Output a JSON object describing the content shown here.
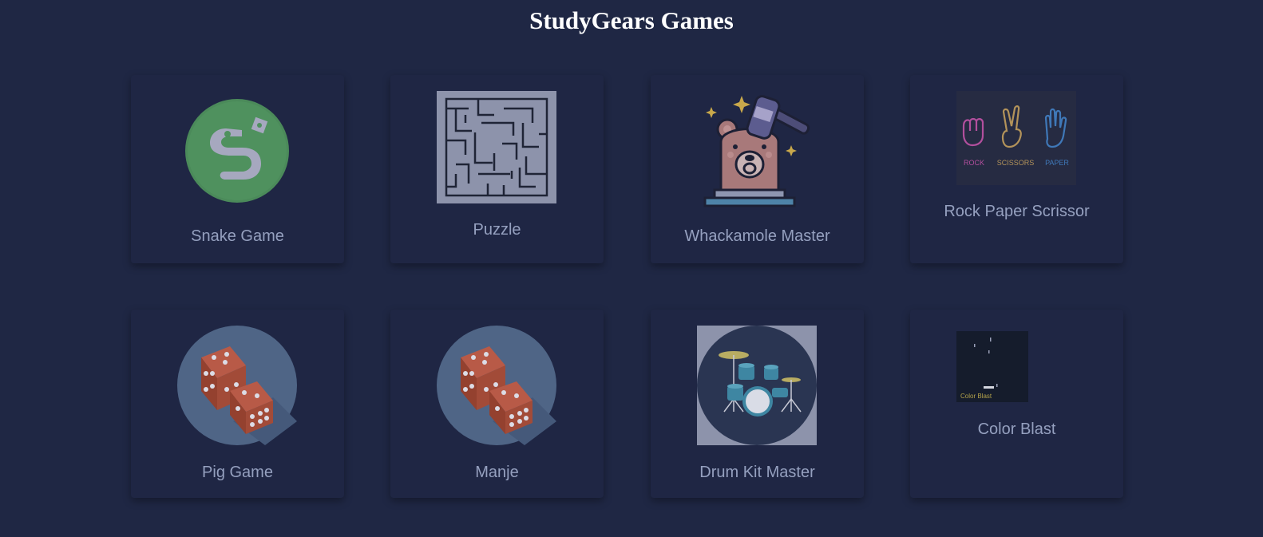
{
  "page": {
    "title": "StudyGears Games"
  },
  "games": [
    {
      "label": "Snake Game",
      "icon": "snake-icon"
    },
    {
      "label": "Puzzle",
      "icon": "maze-icon"
    },
    {
      "label": "Whackamole Master",
      "icon": "bear-hammer-icon"
    },
    {
      "label": "Rock Paper Scrissor",
      "icon": "hands-icon",
      "thumb_text": [
        "ROCK",
        "SCISSORS",
        "PAPER"
      ]
    },
    {
      "label": "Pig Game",
      "icon": "dice-icon"
    },
    {
      "label": "Manje",
      "icon": "dice-icon"
    },
    {
      "label": "Drum Kit Master",
      "icon": "drum-kit-icon"
    },
    {
      "label": "Color Blast",
      "icon": "color-blast-icon",
      "thumb_text": [
        "Color Blast"
      ]
    }
  ],
  "colors": {
    "background": "#1f2744",
    "card": "#1f2644",
    "label": "#95a0bf",
    "title": "#ffffff"
  }
}
